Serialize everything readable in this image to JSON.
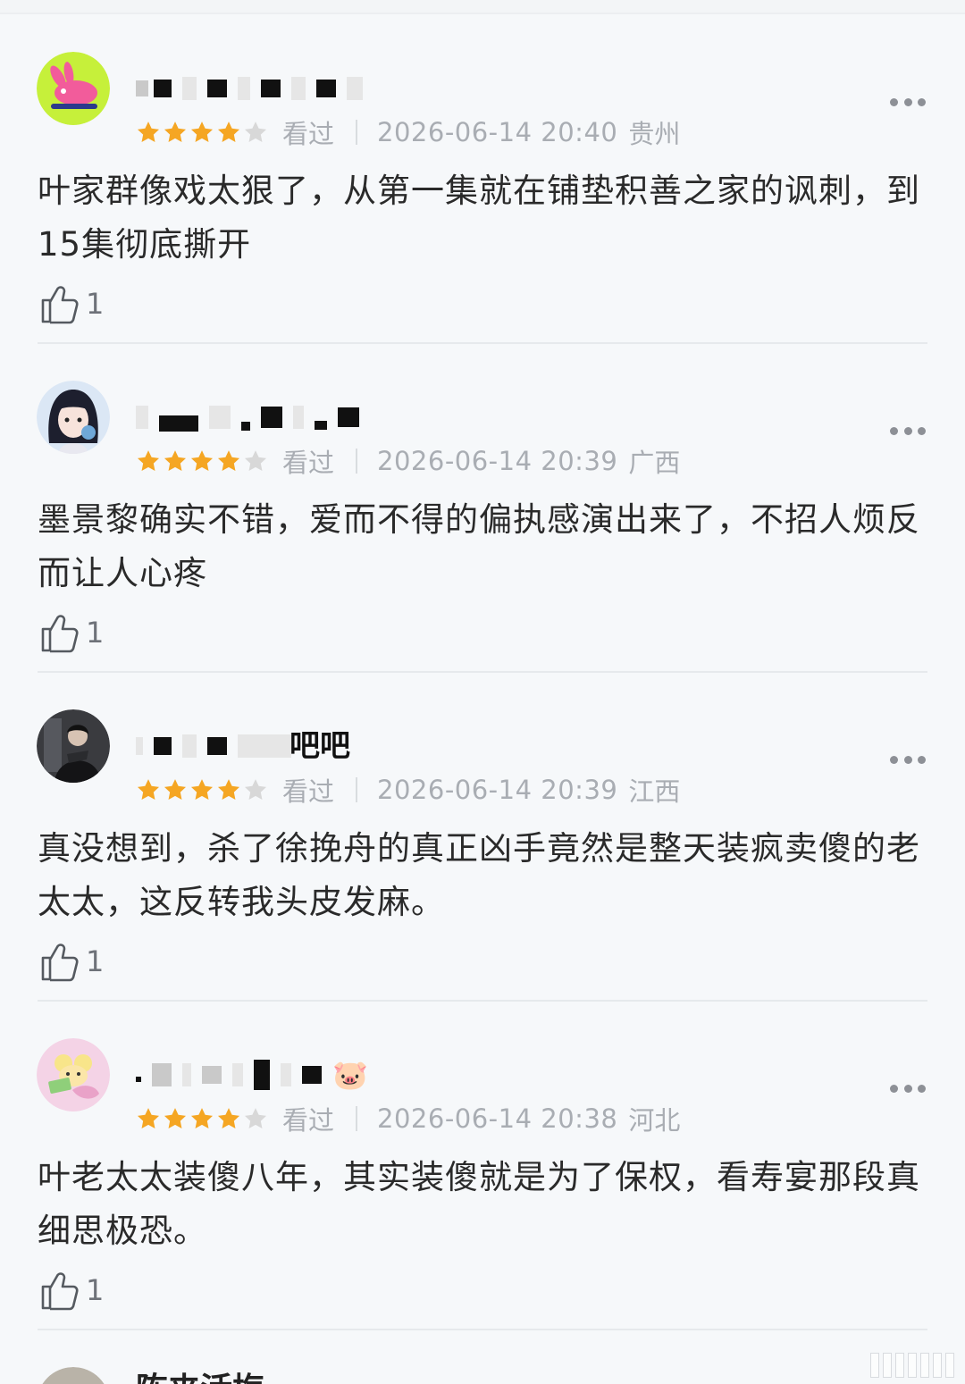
{
  "reviews": [
    {
      "status": "看过",
      "date": "2026-06-14 20:40",
      "location": "贵州",
      "rating": 4,
      "content": "叶家群像戏太狠了，从第一集就在铺垫积善之家的讽刺，到15集彻底撕开",
      "likes": "1",
      "avatar": "pink-rabbit-avatar"
    },
    {
      "status": "看过",
      "date": "2026-06-14 20:39",
      "location": "广西",
      "rating": 4,
      "content": "墨景黎确实不错，爱而不得的偏执感演出来了，不招人烦反而让人心疼",
      "likes": "1",
      "avatar": "anime-girl-avatar"
    },
    {
      "status": "看过",
      "date": "2026-06-14 20:39",
      "location": "江西",
      "rating": 4,
      "content": "真没想到，杀了徐挽舟的真正凶手竟然是整天装疯卖傻的老太太，这反转我头皮发麻。",
      "likes": "1",
      "avatar": "dark-figure-avatar"
    },
    {
      "status": "看过",
      "date": "2026-06-14 20:38",
      "location": "河北",
      "rating": 4,
      "content": "叶老太太装傻八年，其实装傻就是为了保权，看寿宴那段真细思极恐。",
      "likes": "1",
      "avatar": "cartoon-money-avatar"
    }
  ],
  "usernames": {
    "r1_partial": "",
    "r2_partial": "",
    "r3_partial": "吧吧",
    "r4_emoji": "🐷"
  },
  "next_review": {
    "name_partial": "陈夹活梅"
  },
  "colors": {
    "star_filled": "#f5a623",
    "star_empty": "#d8d8d8",
    "meta_text": "#a9adb3",
    "body_text": "#2a2a2a",
    "background": "#f6f8fa"
  }
}
